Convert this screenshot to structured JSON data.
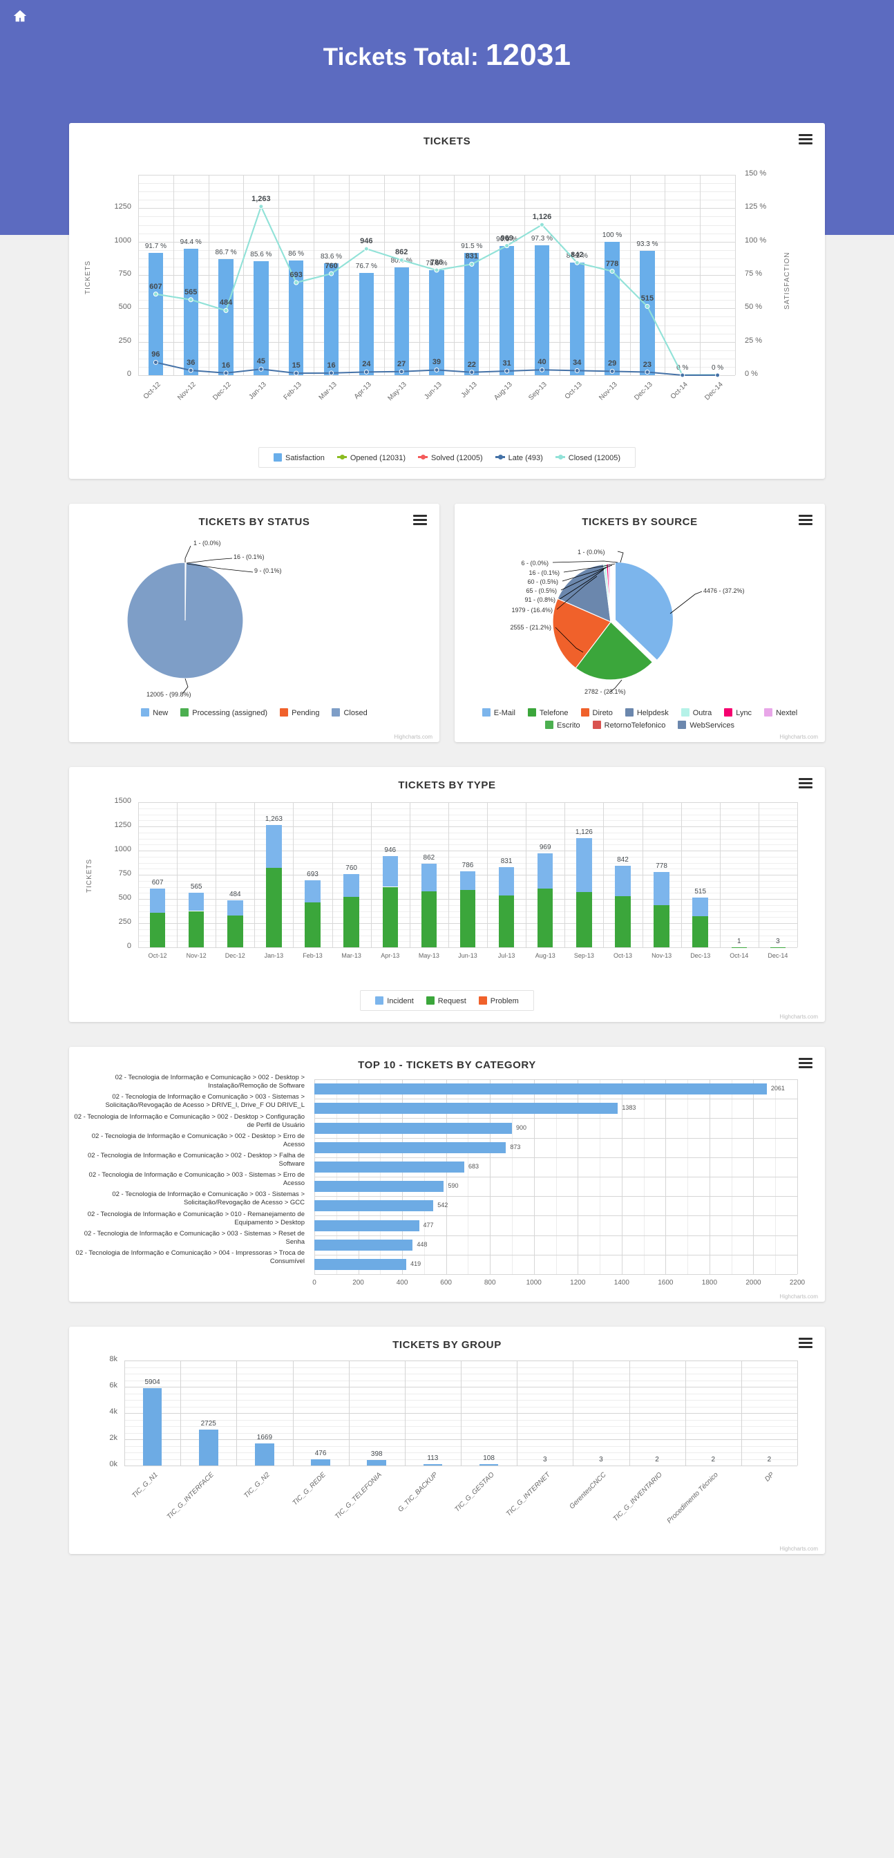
{
  "header": {
    "home_icon": "home-icon",
    "title_prefix": "Tickets Total:",
    "title_value": "12031",
    "bg_color": "#5c6bc0"
  },
  "menu_icon": "hamburger-menu-icon",
  "credit": "Highcharts.com",
  "cards": {
    "tickets": {
      "title": "TICKETS"
    },
    "status": {
      "title": "TICKETS BY STATUS"
    },
    "source": {
      "title": "TICKETS BY SOURCE"
    },
    "type": {
      "title": "TICKETS BY TYPE"
    },
    "category": {
      "title": "TOP 10 - TICKETS BY CATEGORY"
    },
    "group": {
      "title": "TICKETS BY GROUP"
    }
  },
  "chart_data": [
    {
      "id": "tickets",
      "type": "bar",
      "title": "TICKETS",
      "xlabel": "",
      "ylabel": "TICKETS",
      "y2label": "SATISFACTION",
      "ylim": [
        0,
        1500
      ],
      "yticks": [
        0,
        250,
        500,
        750,
        1000,
        1250
      ],
      "y2lim": [
        0,
        150
      ],
      "y2ticks": [
        "0 %",
        "25 %",
        "50 %",
        "75 %",
        "100 %",
        "125 %",
        "150 %"
      ],
      "grid": true,
      "legend_position": "bottom",
      "categories": [
        "Oct-12",
        "Nov-12",
        "Dec-12",
        "Jan-13",
        "Feb-13",
        "Mar-13",
        "Apr-13",
        "May-13",
        "Jun-13",
        "Jul-13",
        "Aug-13",
        "Sep-13",
        "Oct-13",
        "Nov-13",
        "Dec-13",
        "Oct-14",
        "Dec-14"
      ],
      "satisfaction_labels": [
        "91.7 %",
        "94.4 %",
        "86.7 %",
        "85.6 %",
        "86 %",
        "83.6 %",
        "76.7 %",
        "80.9 %",
        "78.6 %",
        "91.5 %",
        "96.9 %",
        "97.3 %",
        "84.2 %",
        "100 %",
        "93.3 %",
        "0 %",
        "0 %"
      ],
      "series": [
        {
          "name": "Satisfaction",
          "color": "#69aeea",
          "type": "column",
          "values": [
            91.7,
            94.4,
            86.7,
            85.6,
            86,
            83.6,
            76.7,
            80.9,
            78.6,
            91.5,
            96.9,
            97.3,
            84.2,
            100,
            93.3,
            0,
            0
          ]
        },
        {
          "name": "Opened (12031)",
          "color": "#8bbc21",
          "type": "line",
          "values": [
            607,
            565,
            484,
            1263,
            693,
            760,
            946,
            862,
            786,
            831,
            969,
            1126,
            842,
            778,
            515,
            1,
            3
          ]
        },
        {
          "name": "Solved (12005)",
          "color": "#f45b5b",
          "type": "line",
          "values": [
            607,
            565,
            484,
            1263,
            693,
            760,
            946,
            862,
            786,
            831,
            969,
            1126,
            842,
            778,
            515,
            1,
            3
          ]
        },
        {
          "name": "Late (493)",
          "color": "#4572a7",
          "type": "line",
          "values": [
            96,
            36,
            16,
            45,
            15,
            16,
            24,
            27,
            39,
            22,
            31,
            40,
            34,
            29,
            23,
            0,
            0
          ]
        },
        {
          "name": "Closed (12005)",
          "color": "#92e2d8",
          "type": "line",
          "values": [
            607,
            565,
            484,
            1263,
            693,
            760,
            946,
            862,
            786,
            831,
            969,
            1126,
            842,
            778,
            515,
            1,
            3
          ]
        }
      ]
    },
    {
      "id": "status",
      "type": "pie",
      "title": "TICKETS BY STATUS",
      "legend_position": "bottom",
      "labels": [
        "New",
        "Processing (assigned)",
        "Pending",
        "Closed"
      ],
      "colors": [
        "#7cb5ec",
        "#4caf50",
        "#f0612b",
        "#7e9ec7"
      ],
      "values": [
        1,
        16,
        9,
        12005
      ],
      "callouts": [
        "1 - (0.0%)",
        "16 - (0.1%)",
        "9 - (0.1%)",
        "12005 - (99.8%)"
      ]
    },
    {
      "id": "source",
      "type": "pie",
      "title": "TICKETS BY SOURCE",
      "legend_position": "bottom",
      "labels": [
        "E-Mail",
        "Telefone",
        "Direto",
        "Helpdesk",
        "Outra",
        "Lync",
        "Nextel",
        "Escrito",
        "RetornoTelefonico",
        "WebServices"
      ],
      "colors": [
        "#7cb5ec",
        "#3ba63b",
        "#f0612b",
        "#6b87ad",
        "#b5f2e8",
        "#f5006f",
        "#e8a6e8",
        "#4caf50",
        "#d9534f",
        "#6b87ad"
      ],
      "values": [
        4476,
        2782,
        2555,
        1979,
        91,
        65,
        60,
        16,
        6,
        1
      ],
      "callouts": [
        "4476 - (37.2%)",
        "2782 - (23.1%)",
        "2555 - (21.2%)",
        "1979 - (16.4%)",
        "91 - (0.8%)",
        "65 - (0.5%)",
        "60 - (0.5%)",
        "16 - (0.1%)",
        "6 - (0.0%)",
        "1 - (0.0%)"
      ]
    },
    {
      "id": "type",
      "type": "bar",
      "stacked": true,
      "title": "TICKETS BY TYPE",
      "ylabel": "TICKETS",
      "ylim": [
        0,
        1500
      ],
      "yticks": [
        0,
        250,
        500,
        750,
        1000,
        1250,
        1500
      ],
      "grid": true,
      "legend_position": "bottom",
      "categories": [
        "Oct-12",
        "Nov-12",
        "Dec-12",
        "Jan-13",
        "Feb-13",
        "Mar-13",
        "Apr-13",
        "May-13",
        "Jun-13",
        "Jul-13",
        "Aug-13",
        "Sep-13",
        "Oct-13",
        "Nov-13",
        "Dec-13",
        "Oct-14",
        "Dec-14"
      ],
      "totals": [
        "607",
        "565",
        "484",
        "1,263",
        "693",
        "760",
        "946",
        "862",
        "786",
        "831",
        "969",
        "1,126",
        "842",
        "778",
        "515",
        "1",
        "3"
      ],
      "series": [
        {
          "name": "Incident",
          "color": "#7cb5ec",
          "values": [
            248,
            190,
            153,
            440,
            227,
            242,
            321,
            282,
            193,
            296,
            364,
            558,
            310,
            340,
            193,
            0,
            0
          ]
        },
        {
          "name": "Request",
          "color": "#3ba63b",
          "values": [
            359,
            375,
            331,
            823,
            466,
            518,
            625,
            580,
            593,
            535,
            605,
            568,
            532,
            438,
            322,
            1,
            3
          ]
        },
        {
          "name": "Problem",
          "color": "#f0612b",
          "values": [
            0,
            0,
            0,
            0,
            0,
            0,
            0,
            0,
            0,
            0,
            0,
            0,
            0,
            0,
            0,
            0,
            0
          ]
        }
      ]
    },
    {
      "id": "category",
      "type": "bar",
      "orientation": "horizontal",
      "title": "TOP 10 - TICKETS BY CATEGORY",
      "xlim": [
        0,
        2200
      ],
      "xticks": [
        0,
        200,
        400,
        600,
        800,
        1000,
        1200,
        1400,
        1600,
        1800,
        2000,
        2200
      ],
      "grid": true,
      "categories": [
        "02 - Tecnologia de Informação e Comunicação > 002 - Desktop > Instalação/Remoção de Software",
        "02 - Tecnologia de Informação e Comunicação > 003 - Sistemas > Solicitação/Revogação de Acesso > DRIVE_I, Drive_F OU DRIVE_L",
        "02 - Tecnologia de Informação e Comunicação > 002 - Desktop > Configuração de Perfil de Usuário",
        "02 - Tecnologia de Informação e Comunicação > 002 - Desktop > Erro de Acesso",
        "02 - Tecnologia de Informação e Comunicação > 002 - Desktop > Falha de Software",
        "02 - Tecnologia de Informação e Comunicação > 003 - Sistemas > Erro de Acesso",
        "02 - Tecnologia de Informação e Comunicação > 003 - Sistemas > Solicitação/Revogação de Acesso > GCC",
        "02 - Tecnologia de Informação e Comunicação > 010 - Remanejamento de Equipamento > Desktop",
        "02 - Tecnologia de Informação e Comunicação > 003 - Sistemas > Reset de Senha",
        "02 - Tecnologia de Informação e Comunicação > 004 - Impressoras > Troca de Consumível"
      ],
      "values": [
        2061,
        1383,
        900,
        873,
        683,
        590,
        542,
        477,
        448,
        419
      ],
      "color": "#6dabe4"
    },
    {
      "id": "group",
      "type": "bar",
      "title": "TICKETS BY GROUP",
      "ylim": [
        0,
        8000
      ],
      "yticks": [
        "0k",
        "2k",
        "4k",
        "6k",
        "8k"
      ],
      "grid": true,
      "categories": [
        "TIC_G_N1",
        "TIC_G_INTERFACE",
        "TIC_G_N2",
        "TIC_G_REDE",
        "TIC_G_TELEFONIA",
        "G_TIC_BACKUP",
        "TIC_G_GESTAO",
        "TIC_G_INTERNET",
        "GerentesCNCC",
        "TIC_G_INVENTARIO",
        "Procedimento Técnico",
        "DP"
      ],
      "values": [
        5904,
        2725,
        1669,
        476,
        398,
        113,
        108,
        3,
        3,
        2,
        2,
        2
      ],
      "labels": [
        "5904",
        "2725",
        "1669",
        "476",
        "398",
        "113",
        "108",
        "3",
        "3",
        "2",
        "2",
        "2"
      ],
      "color": "#6dabe4"
    }
  ]
}
